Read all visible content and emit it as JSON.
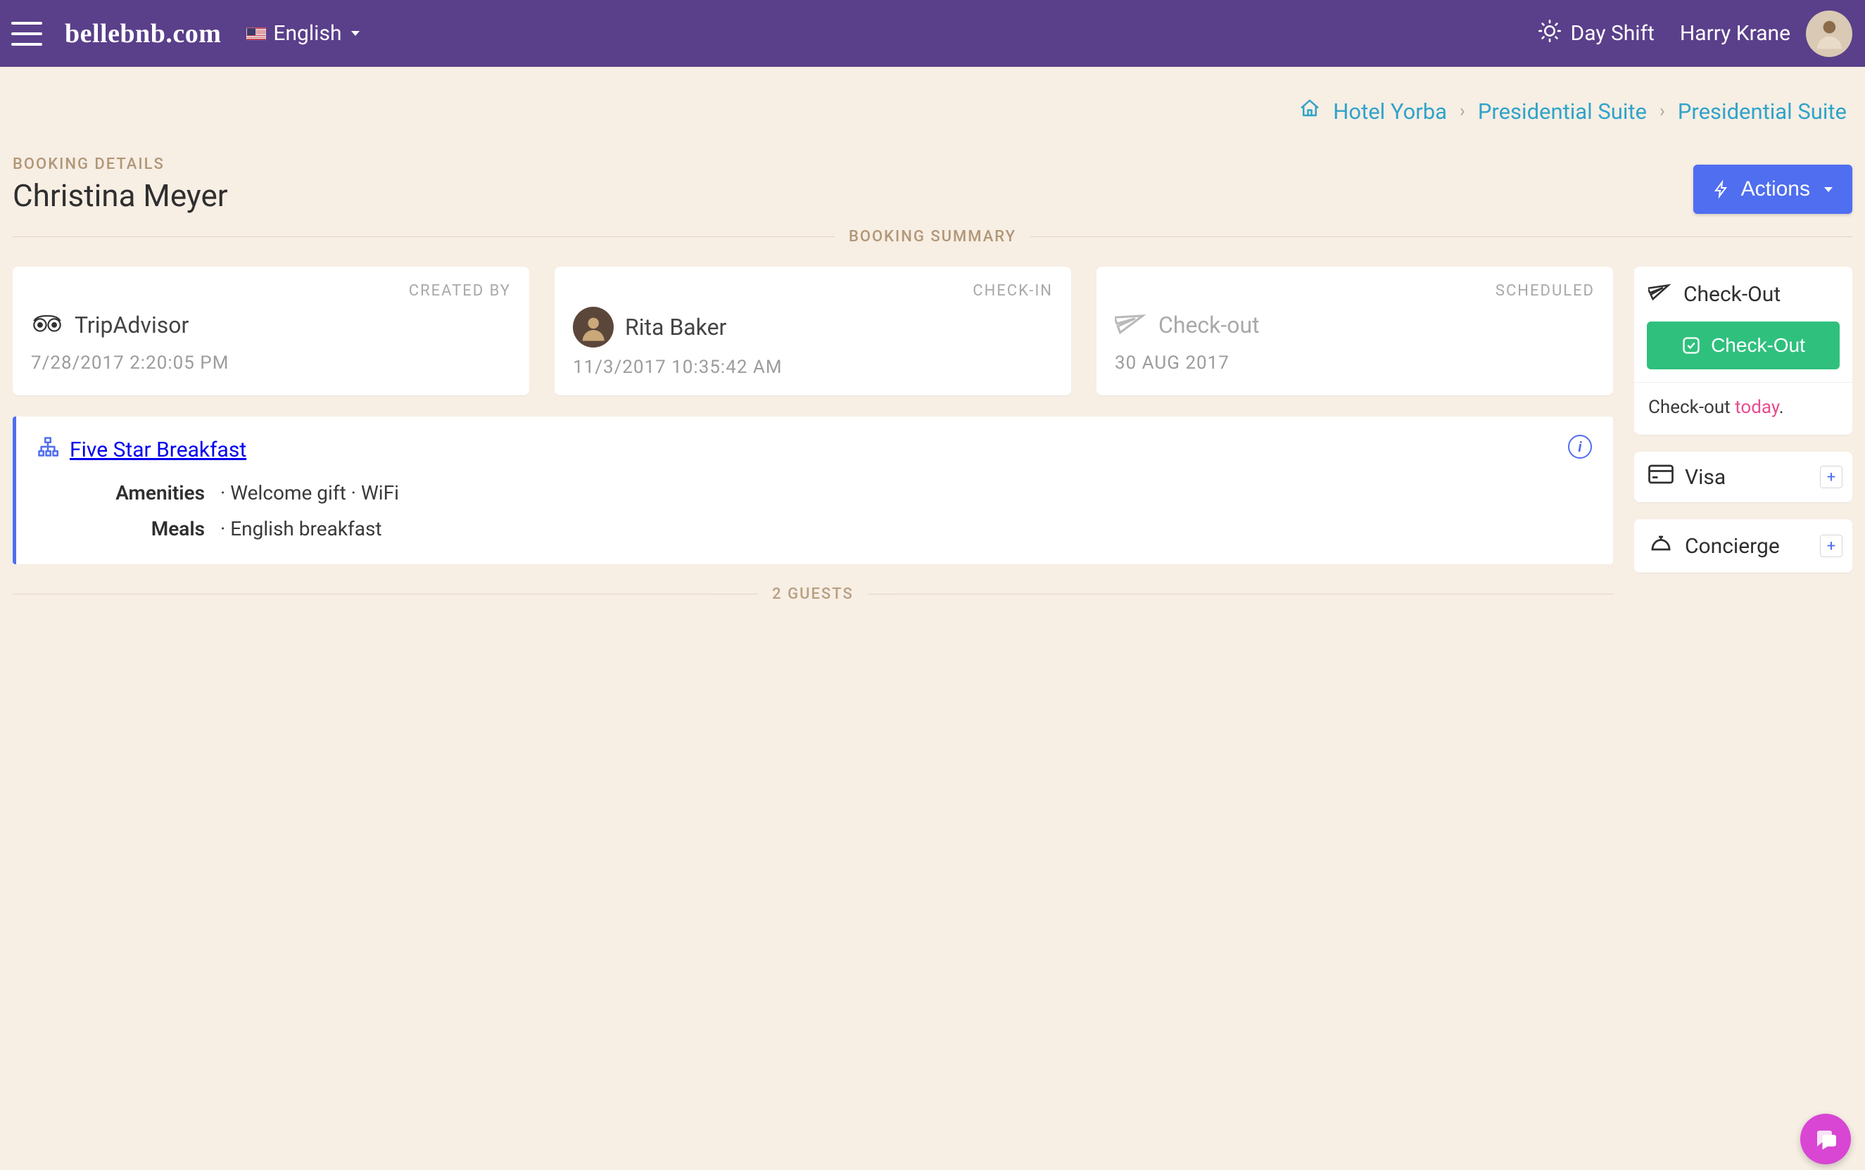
{
  "header": {
    "brand": "bellebnb.com",
    "language": "English",
    "shift_label": "Day Shift",
    "user_name": "Harry Krane"
  },
  "breadcrumbs": {
    "hotel": "Hotel Yorba",
    "room_type": "Presidential Suite",
    "room": "Presidential Suite"
  },
  "booking": {
    "section_label": "BOOKING DETAILS",
    "guest_name": "Christina Meyer",
    "actions_label": "Actions",
    "summary_label": "BOOKING SUMMARY"
  },
  "summary": {
    "created": {
      "label": "CREATED BY",
      "source": "TripAdvisor",
      "timestamp": "7/28/2017 2:20:05 PM"
    },
    "checkin": {
      "label": "CHECK-IN",
      "by": "Rita Baker",
      "timestamp": "11/3/2017 10:35:42 AM"
    },
    "scheduled": {
      "label": "SCHEDULED",
      "event": "Check-out",
      "date": "30 AUG 2017"
    }
  },
  "plan": {
    "name": "Five Star Breakfast",
    "amenities_label": "Amenities",
    "amenities": "· Welcome gift   · WiFi",
    "meals_label": "Meals",
    "meals": "· English breakfast"
  },
  "guests_label": "2 GUESTS",
  "rail": {
    "checkout": {
      "title": "Check-Out",
      "button": "Check-Out",
      "note_prefix": "Check-out ",
      "note_highlight": "today",
      "note_suffix": "."
    },
    "payment": {
      "title": "Visa"
    },
    "concierge": {
      "title": "Concierge"
    }
  }
}
